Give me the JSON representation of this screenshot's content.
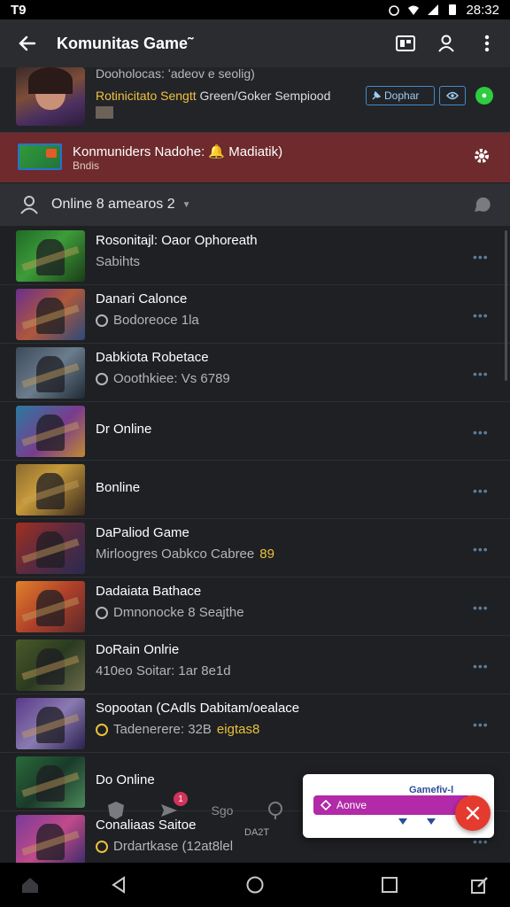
{
  "status_bar": {
    "left_text": "T9",
    "time": "28:32"
  },
  "app_bar": {
    "title": "Komunitas Game˜"
  },
  "profile": {
    "subtitle": "Dooholocas: ʻadeov e seolig)",
    "desc_highlight": "Rotinicitato Sengtt",
    "desc_rest": " Green/Goker Sempiood",
    "button_label": "Dophar"
  },
  "banner": {
    "title": "Konmuniders Nadohe: 🔔 Madiatik)",
    "subtitle": "Bndis"
  },
  "section": {
    "label": "Online 8 amearos 2"
  },
  "games": [
    {
      "title": "Rosonitajl: Oaor Ophoreath",
      "meta": "Sabihts",
      "icon": "",
      "hl": "",
      "gradient": "linear-gradient(135deg,#1f6b27,#3d9c3a 45%,#1a3d18)"
    },
    {
      "title": "Danari Calonce",
      "meta": "Bodoreoce 1la",
      "icon": "ring",
      "hl": "",
      "gradient": "linear-gradient(135deg,#6a2f8e,#b0583a 50%,#2b4a7a)"
    },
    {
      "title": "Dabkiota Robetace",
      "meta": "Ooothkiee: Vs 6789",
      "icon": "ring",
      "hl": "",
      "gradient": "linear-gradient(135deg,#3d4a5a,#6b7c8c 50%,#1f2a36)"
    },
    {
      "title": "Dr Online",
      "meta": "",
      "icon": "",
      "hl": "",
      "gradient": "linear-gradient(135deg,#2a7aa0,#7a3b8e 55%,#c08a30)"
    },
    {
      "title": "Bonline",
      "meta": "",
      "icon": "",
      "hl": "",
      "gradient": "linear-gradient(135deg,#8a6a30,#c79a3a 40%,#3a2a20)"
    },
    {
      "title": "DaPaliod Game",
      "meta": "Mirloogres Oabkco Cabree",
      "icon": "",
      "hl": "89",
      "gradient": "linear-gradient(135deg,#a03020,#5a2a40 50%,#2a2a50)"
    },
    {
      "title": "Dadaiata Bathace",
      "meta": "Dmnonocke 8 Seajthe",
      "icon": "ring",
      "hl": "",
      "gradient": "linear-gradient(135deg,#e0802a,#b0402a 50%,#5a2a2a)"
    },
    {
      "title": "DoRain Onlrie",
      "meta": "410eo Soitar: 1ar 8e1d",
      "icon": "",
      "hl": "",
      "gradient": "linear-gradient(135deg,#4a5a2a,#2a3a20 50%,#6a6a4a)"
    },
    {
      "title": "Sopootan (CAdls Dabitam/oealace",
      "meta": "Tadenerere: 32B",
      "icon": "yring",
      "hl": "eigtas8",
      "gradient": "linear-gradient(135deg,#5a3a8a,#8a7ab0 50%,#2a2050)"
    },
    {
      "title": "Do Online",
      "meta": "",
      "icon": "",
      "hl": "",
      "gradient": "linear-gradient(135deg,#2a6a3a,#1a3a2a 50%,#4a8a5a)"
    },
    {
      "title": "Conaliaas Saitoe",
      "meta": "Drdartkase (12at8lel",
      "icon": "yring",
      "hl": "",
      "gradient": "linear-gradient(135deg,#7a3a9a,#c04a8a 50%,#3a2a6a)"
    }
  ],
  "tabbar": {
    "badge_count": "1",
    "tab_label": "Sgo",
    "bottom_text": "DA2T"
  },
  "popup": {
    "head": "Gamefiv-l",
    "bar_label": "Aonve"
  },
  "colors": {
    "accent_blue": "#3e8ccc",
    "banner_red": "#6e2a2c",
    "online_green": "#2ecc40",
    "fab_red": "#e53a2f",
    "popup_magenta": "#b22aa8"
  }
}
